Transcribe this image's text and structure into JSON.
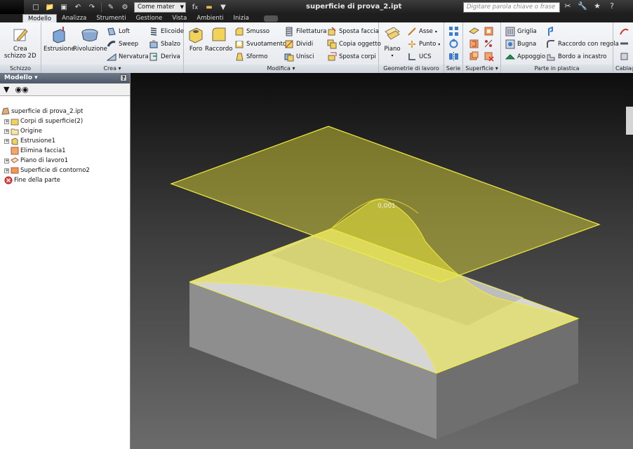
{
  "window": {
    "document_title": "superficie di prova_2.ipt",
    "appearance_combo": "Come mater",
    "search_placeholder": "Digitare parola chiave o frase"
  },
  "tabs": [
    "Modello",
    "Analizza",
    "Strumenti",
    "Gestione",
    "Vista",
    "Ambienti",
    "Inizia"
  ],
  "ribbon": {
    "panels": {
      "schizzo": "Schizzo",
      "crea": "Crea",
      "modifica": "Modifica",
      "geometrie": "Geometrie di lavoro",
      "serie": "Serie",
      "superficie": "Superficie",
      "parte_plastica": "Parte in plastica",
      "cablaggio": "Cablag"
    },
    "crea_schizzo": [
      "Crea",
      "schizzo 2D"
    ],
    "estrusione": "Estrusione",
    "rivoluzione": "Rivoluzione",
    "loft": "Loft",
    "sweep": "Sweep",
    "nervatura": "Nervatura",
    "elicoide": "Elicoide",
    "sbalzo": "Sbalzo",
    "deriva": "Deriva",
    "foro": "Foro",
    "raccordo": "Raccordo",
    "smusso": "Smusso",
    "svuotamento": "Svuotamento",
    "sformo": "Sformo",
    "filettatura": "Filettatura",
    "dividi": "Dividi",
    "unisci": "Unisci",
    "sposta_faccia": "Sposta faccia",
    "copia_oggetto": "Copia oggetto",
    "sposta_corpi": "Sposta corpi",
    "piano": "Piano",
    "asse": "Asse",
    "punto": "Punto",
    "ucs": "UCS",
    "griglia": "Griglia",
    "bugna": "Bugna",
    "appoggio": "Appoggio",
    "raccordo_regola": "Raccordo con regola",
    "bordo_incastro": "Bordo a incastro"
  },
  "browser": {
    "title": "Modello",
    "tree": [
      {
        "label": "superficie di prova_2.ipt",
        "level": 0,
        "expander": ""
      },
      {
        "label": "Corpi di superficie(2)",
        "level": 1,
        "expander": "+"
      },
      {
        "label": "Origine",
        "level": 1,
        "expander": "+"
      },
      {
        "label": "Estrusione1",
        "level": 1,
        "expander": "+"
      },
      {
        "label": "Elimina faccia1",
        "level": 1,
        "expander": ""
      },
      {
        "label": "Piano di lavoro1",
        "level": 1,
        "expander": "+"
      },
      {
        "label": "Superficie di contorno2",
        "level": 1,
        "expander": "+"
      },
      {
        "label": "Fine della parte",
        "level": 1,
        "expander": ""
      }
    ]
  },
  "viewport": {
    "dimension_label": "0,001"
  },
  "colors": {
    "surface_fill": "#e8e33a",
    "surface_edge": "#f0ec40",
    "solid_top": "#d9d9d9",
    "solid_side": "#8f8f8f"
  }
}
